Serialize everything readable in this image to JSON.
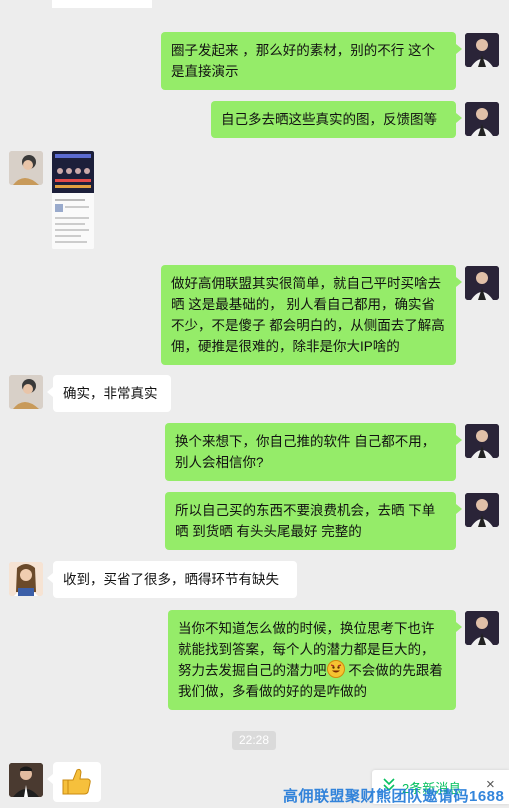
{
  "colors": {
    "background": "#ededed",
    "sent_bubble": "#95ec69",
    "received_bubble": "#ffffff",
    "new_msg_accent": "#07c160",
    "watermark": "#1e78d8"
  },
  "messages": [
    {
      "side": "right",
      "type": "text",
      "text": "圈子发起来 ，那么好的素材，别的不行 这个是直接演示"
    },
    {
      "side": "right",
      "type": "text",
      "text": "自己多去晒这些真实的图，反馈图等"
    },
    {
      "side": "left",
      "type": "image",
      "image_icon": "screenshot-thumbnail"
    },
    {
      "side": "right",
      "type": "text",
      "text": "做好高佣联盟其实很简单，就自己平时买啥去晒 这是最基础的， 别人看自己都用，确实省不少，不是傻子 都会明白的，从侧面去了解高佣，硬推是很难的，除非是你大IP啥的"
    },
    {
      "side": "left",
      "type": "text",
      "text": "确实，非常真实"
    },
    {
      "side": "right",
      "type": "text",
      "text": "换个来想下，你自己推的软件 自己都不用，别人会相信你?"
    },
    {
      "side": "right",
      "type": "text",
      "text": "所以自己买的东西不要浪费机会，去晒 下单晒 到货晒 有头头尾最好 完整的"
    },
    {
      "side": "left",
      "type": "text",
      "text": "收到，买省了很多，晒得环节有缺失"
    },
    {
      "side": "right",
      "type": "text",
      "text_before_emoji": "当你不知道怎么做的时候，换位思考下也许就能找到答案，每个人的潜力都是巨大的，努力去发掘自己的潜力吧",
      "emoji": "grinning-face-emoji",
      "text_after_emoji": " 不会做的先跟着我们做，多看做的好的是咋做的"
    },
    {
      "side": "left",
      "type": "sticker",
      "sticker_icon": "thumbs-up-icon"
    }
  ],
  "timestamp": "22:28",
  "new_messages_label": "2条新消息",
  "close_label": "×",
  "watermark_text": "高佣联盟聚财熊团队邀请码1688"
}
